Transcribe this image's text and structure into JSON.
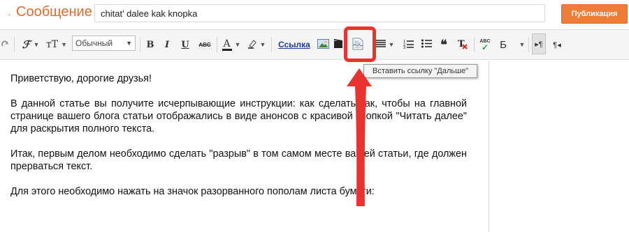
{
  "header": {
    "title": "Сообщение",
    "post_title_value": "chitat' dalee kak knopka",
    "publish_label": "Публикация"
  },
  "toolbar": {
    "font_select_value": "Обычный",
    "bold": "B",
    "italic": "I",
    "underline": "U",
    "strike": "ABC",
    "text_color": "A",
    "link_label": "Ссылка",
    "spellcheck_text": "ABC",
    "format_letter": "Б",
    "ltr": "¶",
    "rtl": "¶"
  },
  "tooltip": {
    "text": "Вставить ссылку \"Дальше\""
  },
  "editor": {
    "paragraphs": [
      "Приветствую, дорогие друзья!",
      "В данной статье вы получите исчерпывающие инструкции: как сделать так, чтобы на главной странице вашего блога статьи отображались в виде анонсов с красивой кнопкой \"Читать далее\" для раскрытия полного текста.",
      "Итак, первым делом необходимо сделать \"разрыв\" в том самом месте вашей статьи, где должен прерваться текст.",
      "Для этого необходимо нажать на значок разорванного пополам листа бумаги:"
    ]
  },
  "colors": {
    "accent": "#dd6d2f",
    "publish": "#f07d35",
    "annotation": "#e8332f",
    "link": "#1a3c9e"
  },
  "icons": [
    "redo-icon",
    "font-family-icon",
    "font-size-icon",
    "highlight-icon",
    "image-icon",
    "video-icon",
    "jump-break-icon",
    "align-icon",
    "numbered-list-icon",
    "bullet-list-icon",
    "quote-icon",
    "clear-format-icon",
    "spellcheck-icon"
  ]
}
